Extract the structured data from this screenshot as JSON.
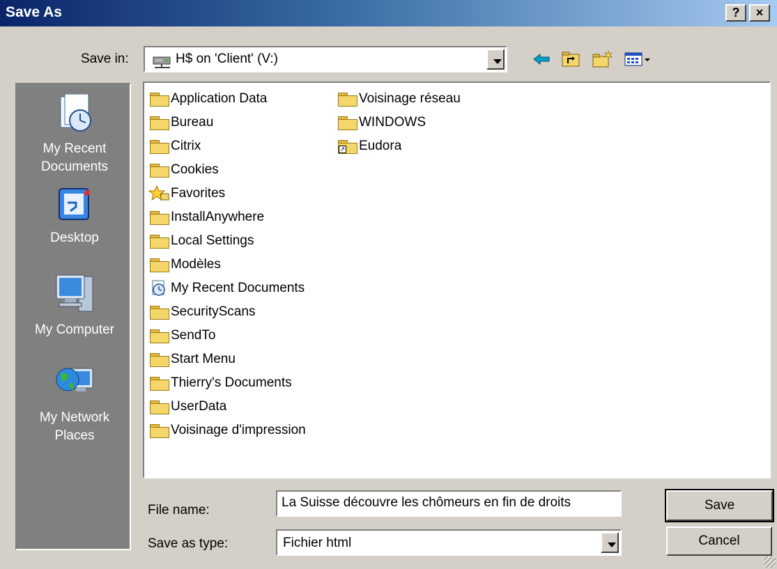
{
  "window": {
    "title": "Save As",
    "help_btn": "?",
    "close_btn": "×"
  },
  "save_in": {
    "label": "Save in:",
    "value": "H$ on 'Client' (V:)"
  },
  "places": [
    {
      "label_1": "My Recent",
      "label_2": "Documents"
    },
    {
      "label_1": "Desktop"
    },
    {
      "label_1": "My Computer"
    },
    {
      "label_1": "My Network",
      "label_2": "Places"
    }
  ],
  "files": {
    "col1": [
      "Application Data",
      "Bureau",
      "Citrix",
      "Cookies",
      "Favorites",
      "InstallAnywhere",
      "Local Settings",
      "Modèles",
      "My Recent Documents",
      "SecurityScans",
      "SendTo",
      "Start Menu",
      "Thierry's Documents",
      "UserData",
      "Voisinage d'impression"
    ],
    "col2": [
      "Voisinage réseau",
      "WINDOWS",
      "Eudora"
    ]
  },
  "file_name": {
    "label": "File name:",
    "value": "La Suisse découvre les chômeurs en fin de droits"
  },
  "save_type": {
    "label": "Save as type:",
    "value": "Fichier html"
  },
  "buttons": {
    "save": "Save",
    "cancel": "Cancel"
  }
}
